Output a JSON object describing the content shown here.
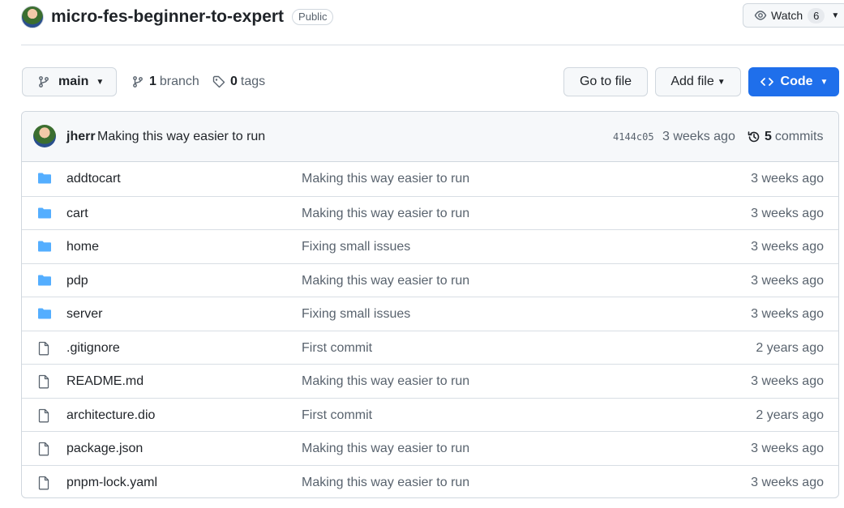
{
  "repo": {
    "name": "micro-fes-beginner-to-expert",
    "visibility": "Public",
    "watch_label": "Watch",
    "watch_count": "6"
  },
  "toolbar": {
    "branch": "main",
    "branches_count": "1",
    "branches_label": "branch",
    "tags_count": "0",
    "tags_label": "tags",
    "goto_label": "Go to file",
    "addfile_label": "Add file",
    "code_label": "Code"
  },
  "commit": {
    "author": "jherr",
    "message": "Making this way easier to run",
    "sha": "4144c05",
    "time": "3 weeks ago",
    "count": "5",
    "count_label": "commits"
  },
  "files": [
    {
      "name": "addtocart",
      "type": "folder",
      "message": "Making this way easier to run",
      "age": "3 weeks ago"
    },
    {
      "name": "cart",
      "type": "folder",
      "message": "Making this way easier to run",
      "age": "3 weeks ago"
    },
    {
      "name": "home",
      "type": "folder",
      "message": "Fixing small issues",
      "age": "3 weeks ago"
    },
    {
      "name": "pdp",
      "type": "folder",
      "message": "Making this way easier to run",
      "age": "3 weeks ago"
    },
    {
      "name": "server",
      "type": "folder",
      "message": "Fixing small issues",
      "age": "3 weeks ago"
    },
    {
      "name": ".gitignore",
      "type": "file",
      "message": "First commit",
      "age": "2 years ago"
    },
    {
      "name": "README.md",
      "type": "file",
      "message": "Making this way easier to run",
      "age": "3 weeks ago"
    },
    {
      "name": "architecture.dio",
      "type": "file",
      "message": "First commit",
      "age": "2 years ago"
    },
    {
      "name": "package.json",
      "type": "file",
      "message": "Making this way easier to run",
      "age": "3 weeks ago"
    },
    {
      "name": "pnpm-lock.yaml",
      "type": "file",
      "message": "Making this way easier to run",
      "age": "3 weeks ago"
    }
  ],
  "colors": {
    "accent": "#1f6feb",
    "folder": "#54aeff",
    "muted": "#59636e"
  }
}
